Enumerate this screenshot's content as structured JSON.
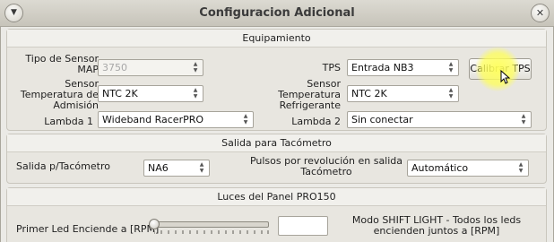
{
  "window": {
    "title": "Configuracion Adicional"
  },
  "equipamiento": {
    "title": "Equipamiento",
    "tipo_sensor_map": {
      "label": "Tipo de Sensor MAP",
      "value": "3750"
    },
    "tps": {
      "label": "TPS",
      "value": "Entrada NB3"
    },
    "calibrar_tps": "Calibrar TPS",
    "sensor_temp_admision": {
      "label": "Sensor Temperatura de Admisión",
      "value": "NTC 2K"
    },
    "sensor_temp_refrigerante": {
      "label": "Sensor Temperatura Refrigerante",
      "value": "NTC 2K"
    },
    "lambda1": {
      "label": "Lambda 1",
      "value": "Wideband RacerPRO"
    },
    "lambda2": {
      "label": "Lambda 2",
      "value": "Sin conectar"
    }
  },
  "salida_tacometro": {
    "title": "Salida para Tacómetro",
    "salida": {
      "label": "Salida p/Tacómetro",
      "value": "NA6"
    },
    "pulsos": {
      "label": "Pulsos por revolución en salida Tacómetro",
      "value": "Automático"
    }
  },
  "luces_panel": {
    "title": "Luces del Panel PRO150",
    "primer_led": {
      "label": "Primer Led Enciende a [RPM]",
      "value": ""
    },
    "shift_light": {
      "label": "Modo SHIFT LIGHT - Todos los leds encienden juntos a [RPM]"
    }
  },
  "icons": {
    "menu": "window-menu-icon",
    "close": "close-icon",
    "combo_arrows": "spin-arrows-icon"
  }
}
